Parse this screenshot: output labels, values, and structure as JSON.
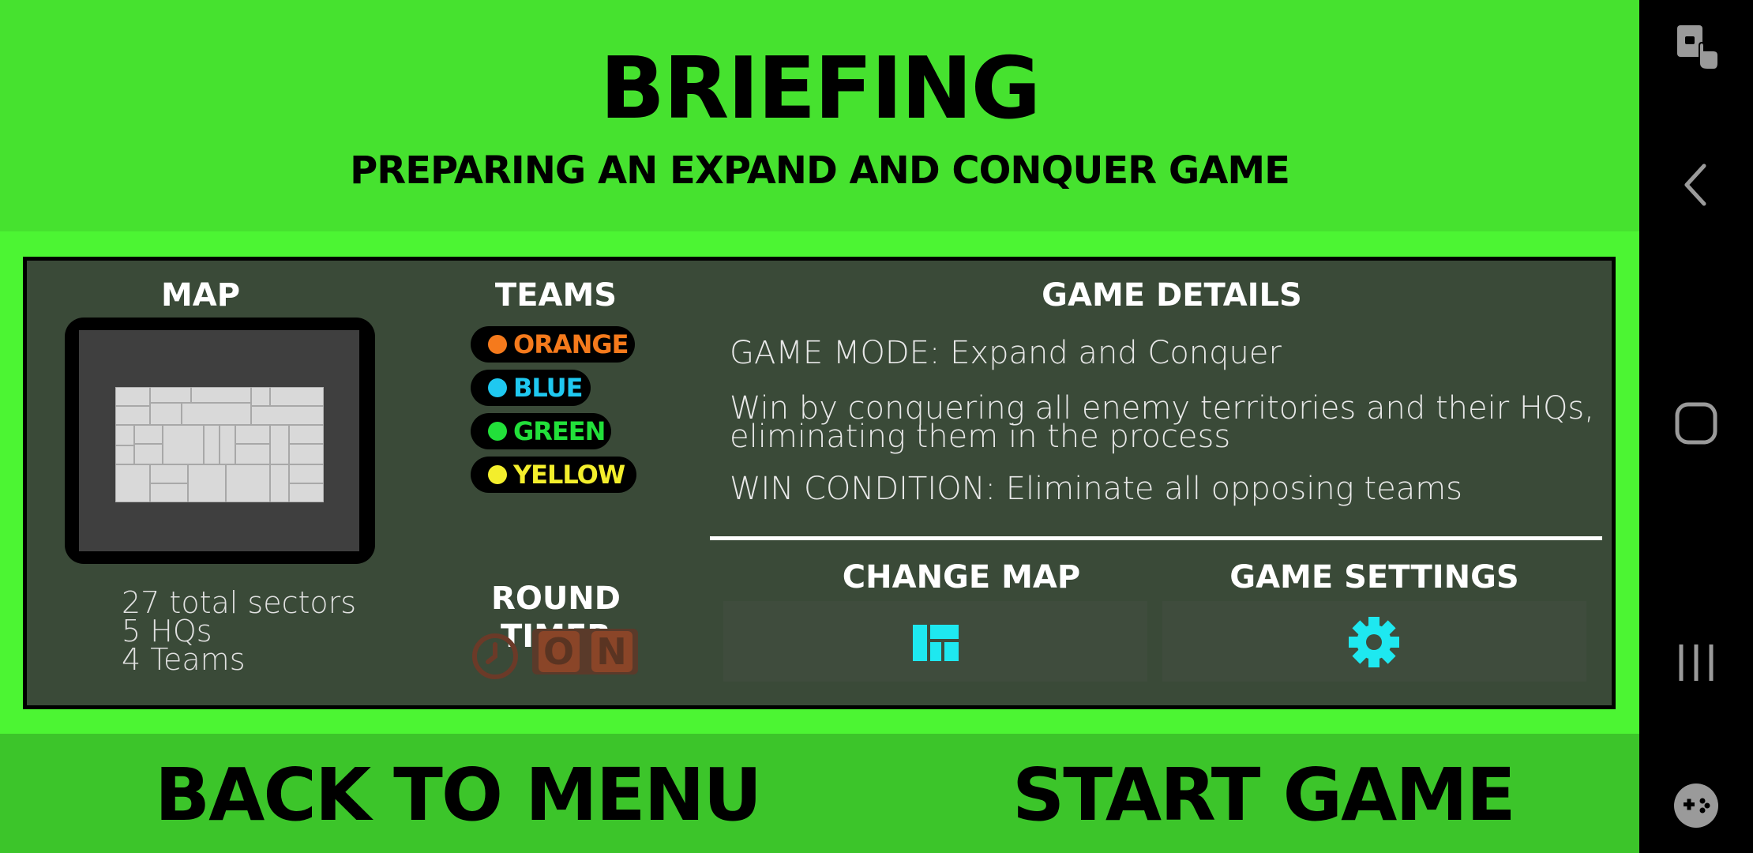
{
  "header": {
    "title": "BRIEFING",
    "subtitle": "PREPARING AN EXPAND AND CONQUER GAME"
  },
  "map_section": {
    "title": "MAP",
    "stats": [
      "27 total sectors",
      "5 HQs",
      "4 Teams"
    ]
  },
  "teams_section": {
    "title": "TEAMS",
    "teams": [
      {
        "label": "ORANGE",
        "color": "#f57a1c"
      },
      {
        "label": "BLUE",
        "color": "#1fc8f0"
      },
      {
        "label": "GREEN",
        "color": "#22e03a"
      },
      {
        "label": "YELLOW",
        "color": "#f3ee2c"
      }
    ]
  },
  "round_timer": {
    "title": "ROUND TIMER",
    "toggle_letters": [
      "O",
      "N"
    ],
    "icon": "clock-icon"
  },
  "game_details": {
    "title": "GAME DETAILS",
    "mode": "GAME MODE: Expand and Conquer",
    "description_line1": "Win by conquering all enemy territories and their HQs,",
    "description_line2": "eliminating them in the process",
    "win_condition": "WIN CONDITION: Eliminate all opposing teams"
  },
  "change_map": {
    "label": "CHANGE MAP",
    "icon": "map-layout-icon",
    "icon_color": "#1ee8f0"
  },
  "game_settings": {
    "label": "GAME SETTINGS",
    "icon": "gear-icon",
    "icon_color": "#1ee8f0"
  },
  "footer": {
    "back_label": "BACK TO MENU",
    "start_label": "START GAME"
  },
  "navbar": {
    "icons": [
      "screen-pin-icon",
      "back-icon",
      "home-icon",
      "recents-icon",
      "game-launcher-icon"
    ]
  },
  "colors": {
    "background": "#4cf533",
    "panel": "#3a4a38",
    "accent": "#1ee8f0"
  }
}
